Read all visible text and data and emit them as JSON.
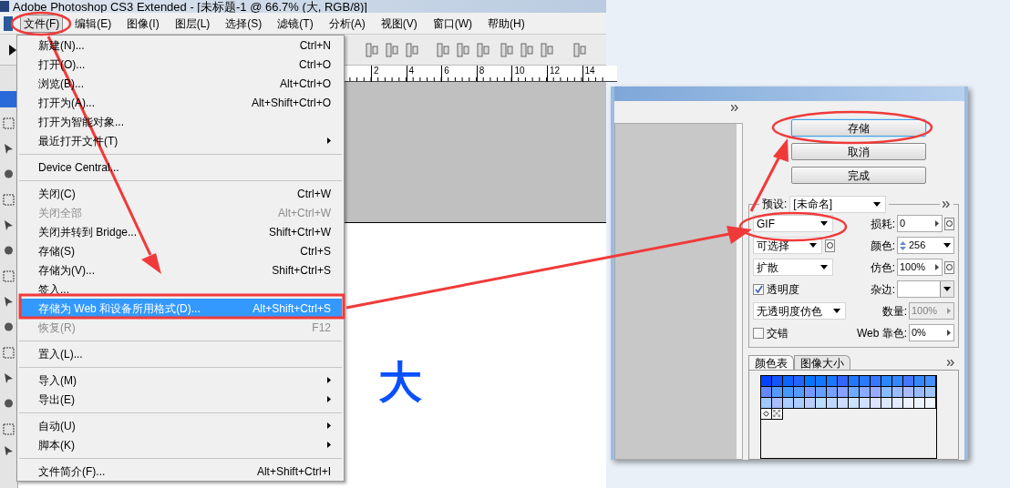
{
  "window": {
    "title": "Adobe Photoshop CS3 Extended - [未标题-1 @ 66.7% (大, RGB/8)]"
  },
  "menu_bar": [
    {
      "label": "文件(F)",
      "selected": true
    },
    {
      "label": "编辑(E)",
      "selected": false
    },
    {
      "label": "图像(I)",
      "selected": false
    },
    {
      "label": "图层(L)",
      "selected": false
    },
    {
      "label": "选择(S)",
      "selected": false
    },
    {
      "label": "滤镜(T)",
      "selected": false
    },
    {
      "label": "分析(A)",
      "selected": false
    },
    {
      "label": "视图(V)",
      "selected": false
    },
    {
      "label": "窗口(W)",
      "selected": false
    },
    {
      "label": "帮助(H)",
      "selected": false
    }
  ],
  "file_menu": [
    {
      "kind": "item",
      "label": "新建(N)...",
      "shortcut": "Ctrl+N",
      "disabled": false,
      "selected": false,
      "submenu": false
    },
    {
      "kind": "item",
      "label": "打开(O)...",
      "shortcut": "Ctrl+O",
      "disabled": false,
      "selected": false,
      "submenu": false
    },
    {
      "kind": "item",
      "label": "浏览(B)...",
      "shortcut": "Alt+Ctrl+O",
      "disabled": false,
      "selected": false,
      "submenu": false
    },
    {
      "kind": "item",
      "label": "打开为(A)...",
      "shortcut": "Alt+Shift+Ctrl+O",
      "disabled": false,
      "selected": false,
      "submenu": false
    },
    {
      "kind": "item",
      "label": "打开为智能对象...",
      "disabled": false,
      "selected": false,
      "submenu": false
    },
    {
      "kind": "item",
      "label": "最近打开文件(T)",
      "disabled": false,
      "selected": false,
      "submenu": true
    },
    {
      "kind": "separator"
    },
    {
      "kind": "item",
      "label": "Device Central...",
      "disabled": false,
      "selected": false,
      "submenu": false
    },
    {
      "kind": "separator"
    },
    {
      "kind": "item",
      "label": "关闭(C)",
      "shortcut": "Ctrl+W",
      "disabled": false,
      "selected": false,
      "submenu": false
    },
    {
      "kind": "item",
      "label": "关闭全部",
      "shortcut": "Alt+Ctrl+W",
      "disabled": true,
      "selected": false,
      "submenu": false
    },
    {
      "kind": "item",
      "label": "关闭并转到 Bridge...",
      "shortcut": "Shift+Ctrl+W",
      "disabled": false,
      "selected": false,
      "submenu": false
    },
    {
      "kind": "item",
      "label": "存储(S)",
      "shortcut": "Ctrl+S",
      "disabled": false,
      "selected": false,
      "submenu": false
    },
    {
      "kind": "item",
      "label": "存储为(V)...",
      "shortcut": "Shift+Ctrl+S",
      "disabled": false,
      "selected": false,
      "submenu": false
    },
    {
      "kind": "item",
      "label": "签入...",
      "disabled": false,
      "selected": false,
      "submenu": false
    },
    {
      "kind": "item",
      "label": "存储为 Web 和设备所用格式(D)...",
      "shortcut": "Alt+Shift+Ctrl+S",
      "disabled": false,
      "selected": true,
      "submenu": false
    },
    {
      "kind": "item",
      "label": "恢复(R)",
      "shortcut": "F12",
      "disabled": true,
      "selected": false,
      "submenu": false
    },
    {
      "kind": "separator"
    },
    {
      "kind": "item",
      "label": "置入(L)...",
      "disabled": false,
      "selected": false,
      "submenu": false
    },
    {
      "kind": "separator"
    },
    {
      "kind": "item",
      "label": "导入(M)",
      "disabled": false,
      "selected": false,
      "submenu": true
    },
    {
      "kind": "item",
      "label": "导出(E)",
      "disabled": false,
      "selected": false,
      "submenu": true
    },
    {
      "kind": "separator"
    },
    {
      "kind": "item",
      "label": "自动(U)",
      "disabled": false,
      "selected": false,
      "submenu": true
    },
    {
      "kind": "item",
      "label": "脚本(K)",
      "disabled": false,
      "selected": false,
      "submenu": true
    },
    {
      "kind": "separator"
    },
    {
      "kind": "item",
      "label": "文件简介(F)...",
      "shortcut": "Alt+Shift+Ctrl+I",
      "disabled": false,
      "selected": false,
      "submenu": false
    }
  ],
  "ruler": {
    "labels": [
      "2",
      "4",
      "6",
      "8",
      "10",
      "12",
      "14"
    ]
  },
  "canvas": {
    "text": "大"
  },
  "dialog": {
    "buttons": [
      {
        "label": "存储",
        "selected": true
      },
      {
        "label": "取消",
        "selected": false
      },
      {
        "label": "完成",
        "selected": false
      }
    ],
    "preset": {
      "label": "预设:",
      "value": "[未命名]"
    },
    "settings": [
      {
        "left": {
          "kind": "select",
          "value": "GIF"
        },
        "right": {
          "kind": "linkedfield",
          "label": "损耗:",
          "value": "0",
          "disabled": false
        }
      },
      {
        "left": {
          "kind": "linked",
          "value": "可选择"
        },
        "right": {
          "kind": "spinner",
          "label": "颜色:",
          "value": "256",
          "disabled": false
        }
      },
      {
        "left": {
          "kind": "select",
          "value": "扩散"
        },
        "right": {
          "kind": "linkedfield",
          "label": "仿色:",
          "value": "100%",
          "disabled": false
        }
      },
      {
        "left": {
          "kind": "checkbox",
          "label": "透明度",
          "checked": true
        },
        "right": {
          "kind": "matte",
          "label": "杂边:",
          "disabled": false
        }
      },
      {
        "left": {
          "kind": "select",
          "value": "无透明度仿色"
        },
        "right": {
          "kind": "field",
          "label": "数量:",
          "value": "100%",
          "disabled": true
        }
      },
      {
        "left": {
          "kind": "checkbox",
          "label": "交错",
          "checked": false
        },
        "right": {
          "kind": "field",
          "label": "Web 靠色:",
          "value": "0%",
          "disabled": false
        }
      }
    ],
    "tabs": [
      {
        "label": "颜色表",
        "selected": true
      },
      {
        "label": "图像大小",
        "selected": false
      }
    ],
    "swatches": [
      {
        "color": "#0044ff"
      },
      {
        "color": "#1155ff"
      },
      {
        "color": "#0a66ff"
      },
      {
        "color": "#2266ff"
      },
      {
        "color": "#0077ff"
      },
      {
        "color": "#1177ff"
      },
      {
        "color": "#1a77ff"
      },
      {
        "color": "#3366ff"
      },
      {
        "color": "#2277ff"
      },
      {
        "color": "#2a7aff"
      },
      {
        "color": "#3a77ff"
      },
      {
        "color": "#2a88ff"
      },
      {
        "color": "#3388ff"
      },
      {
        "color": "#4477ff"
      },
      {
        "color": "#3388fe"
      },
      {
        "color": "#4490ff"
      },
      {
        "color": "#6688ff"
      },
      {
        "color": "#5599ff"
      },
      {
        "color": "#4499ff"
      },
      {
        "color": "#559afe"
      },
      {
        "color": "#7799ff"
      },
      {
        "color": "#66a0ff"
      },
      {
        "color": "#77a0ff"
      },
      {
        "color": "#88a0ff"
      },
      {
        "color": "#70aaff"
      },
      {
        "color": "#88aaff"
      },
      {
        "color": "#99aaff"
      },
      {
        "color": "#88bbff"
      },
      {
        "color": "#99bbff"
      },
      {
        "color": "#aabbff"
      },
      {
        "color": "#99bbfe"
      },
      {
        "color": "#a0c4ff"
      },
      {
        "color": "#a0c8ff"
      },
      {
        "color": "#aabbfe"
      },
      {
        "color": "#aaccff"
      },
      {
        "color": "#aaccfe"
      },
      {
        "color": "#bbccff"
      },
      {
        "color": "#bbddff"
      },
      {
        "color": "#c0d8ff"
      },
      {
        "color": "#ccddff"
      },
      {
        "color": "#cce0ff"
      },
      {
        "color": "#d0e0ff"
      },
      {
        "color": "#dde4ff"
      },
      {
        "color": "#dde8ff"
      },
      {
        "color": "#e0ecff"
      },
      {
        "color": "#eef2ff"
      },
      {
        "color": "#eef4ff"
      },
      {
        "color": "#f0f6ff"
      }
    ]
  }
}
